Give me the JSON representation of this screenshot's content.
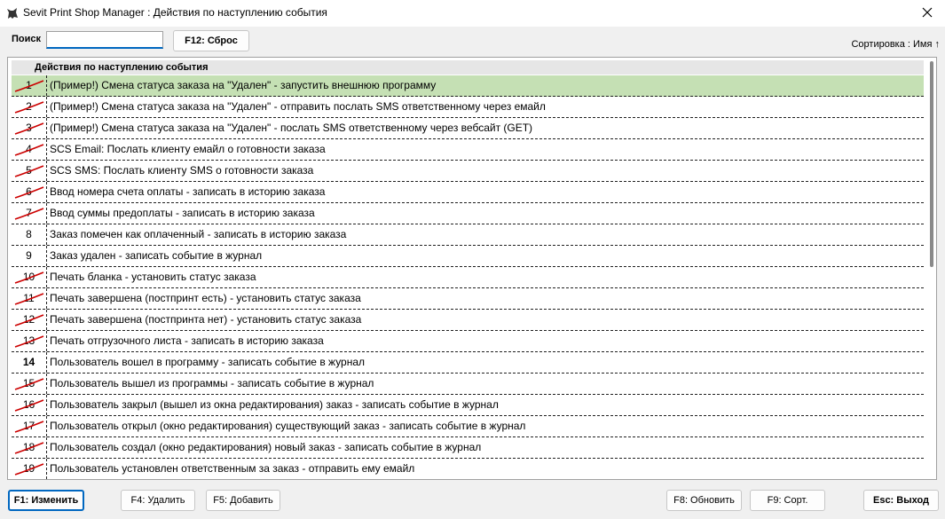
{
  "window": {
    "title": "Sevit Print Shop Manager : Действия по наступлению события"
  },
  "toolbar": {
    "search_label": "Поиск",
    "search_value": "",
    "reset_label": "F12: Сброс",
    "sort_label": "Сортировка : Имя ↑"
  },
  "grid": {
    "header": "Действия по наступлению события",
    "rows": [
      {
        "num": "1",
        "text": "(Пример!) Смена статуса заказа на \"Удален\" - запустить внешнюю программу",
        "disabled": true,
        "selected": true
      },
      {
        "num": "2",
        "text": "(Пример!) Смена статуса заказа на \"Удален\" - отправить послать SMS ответственному через емайл",
        "disabled": true
      },
      {
        "num": "3",
        "text": "(Пример!) Смена статуса заказа на \"Удален\" - послать SMS ответственному через вебсайт (GET)",
        "disabled": true
      },
      {
        "num": "4",
        "text": "SCS Email: Послать клиенту емайл о готовности заказа",
        "disabled": true
      },
      {
        "num": "5",
        "text": "SCS SMS: Послать клиенту SMS о готовности заказа",
        "disabled": true
      },
      {
        "num": "6",
        "text": "Ввод номера счета оплаты - записать в историю заказа",
        "disabled": true
      },
      {
        "num": "7",
        "text": "Ввод суммы предоплаты - записать в историю заказа",
        "disabled": true
      },
      {
        "num": "8",
        "text": "Заказ помечен как оплаченный - записать в историю заказа",
        "disabled": false
      },
      {
        "num": "9",
        "text": "Заказ удален - записать событие в журнал",
        "disabled": false
      },
      {
        "num": "10",
        "text": "Печать бланка - установить статус заказа",
        "disabled": true
      },
      {
        "num": "11",
        "text": "Печать завершена (постпринт есть) - установить статус заказа",
        "disabled": true
      },
      {
        "num": "12",
        "text": "Печать завершена (постпринта нет) - установить статус заказа",
        "disabled": true
      },
      {
        "num": "13",
        "text": "Печать отгрузочного листа - записать в историю заказа",
        "disabled": true
      },
      {
        "num": "14",
        "text": "Пользователь вошел в программу - записать событие в журнал",
        "disabled": false,
        "bold": true
      },
      {
        "num": "15",
        "text": "Пользователь вышел из программы - записать событие в журнал",
        "disabled": true
      },
      {
        "num": "16",
        "text": "Пользователь закрыл (вышел из окна редактирования) заказ - записать событие в журнал",
        "disabled": true
      },
      {
        "num": "17",
        "text": "Пользователь открыл (окно редактирования) существующий заказ - записать событие в журнал",
        "disabled": true
      },
      {
        "num": "18",
        "text": "Пользователь создал (окно редактирования) новый заказ - записать событие в журнал",
        "disabled": true
      },
      {
        "num": "19",
        "text": "Пользователь установлен ответственным за заказ - отправить ему емайл",
        "disabled": true
      }
    ]
  },
  "footer": {
    "edit_label": "F1: Изменить",
    "delete_label": "F4: Удалить",
    "add_label": "F5: Добавить",
    "refresh_label": "F8: Обновить",
    "sort_label": "F9: Сорт.",
    "exit_label": "Esc: Выход"
  },
  "colors": {
    "selected_row": "#c5e0b4",
    "strike": "#cc0000",
    "focus": "#0067c0"
  },
  "icons": {
    "app": "cat-icon",
    "close": "close-icon",
    "disabled": "strike-icon"
  }
}
